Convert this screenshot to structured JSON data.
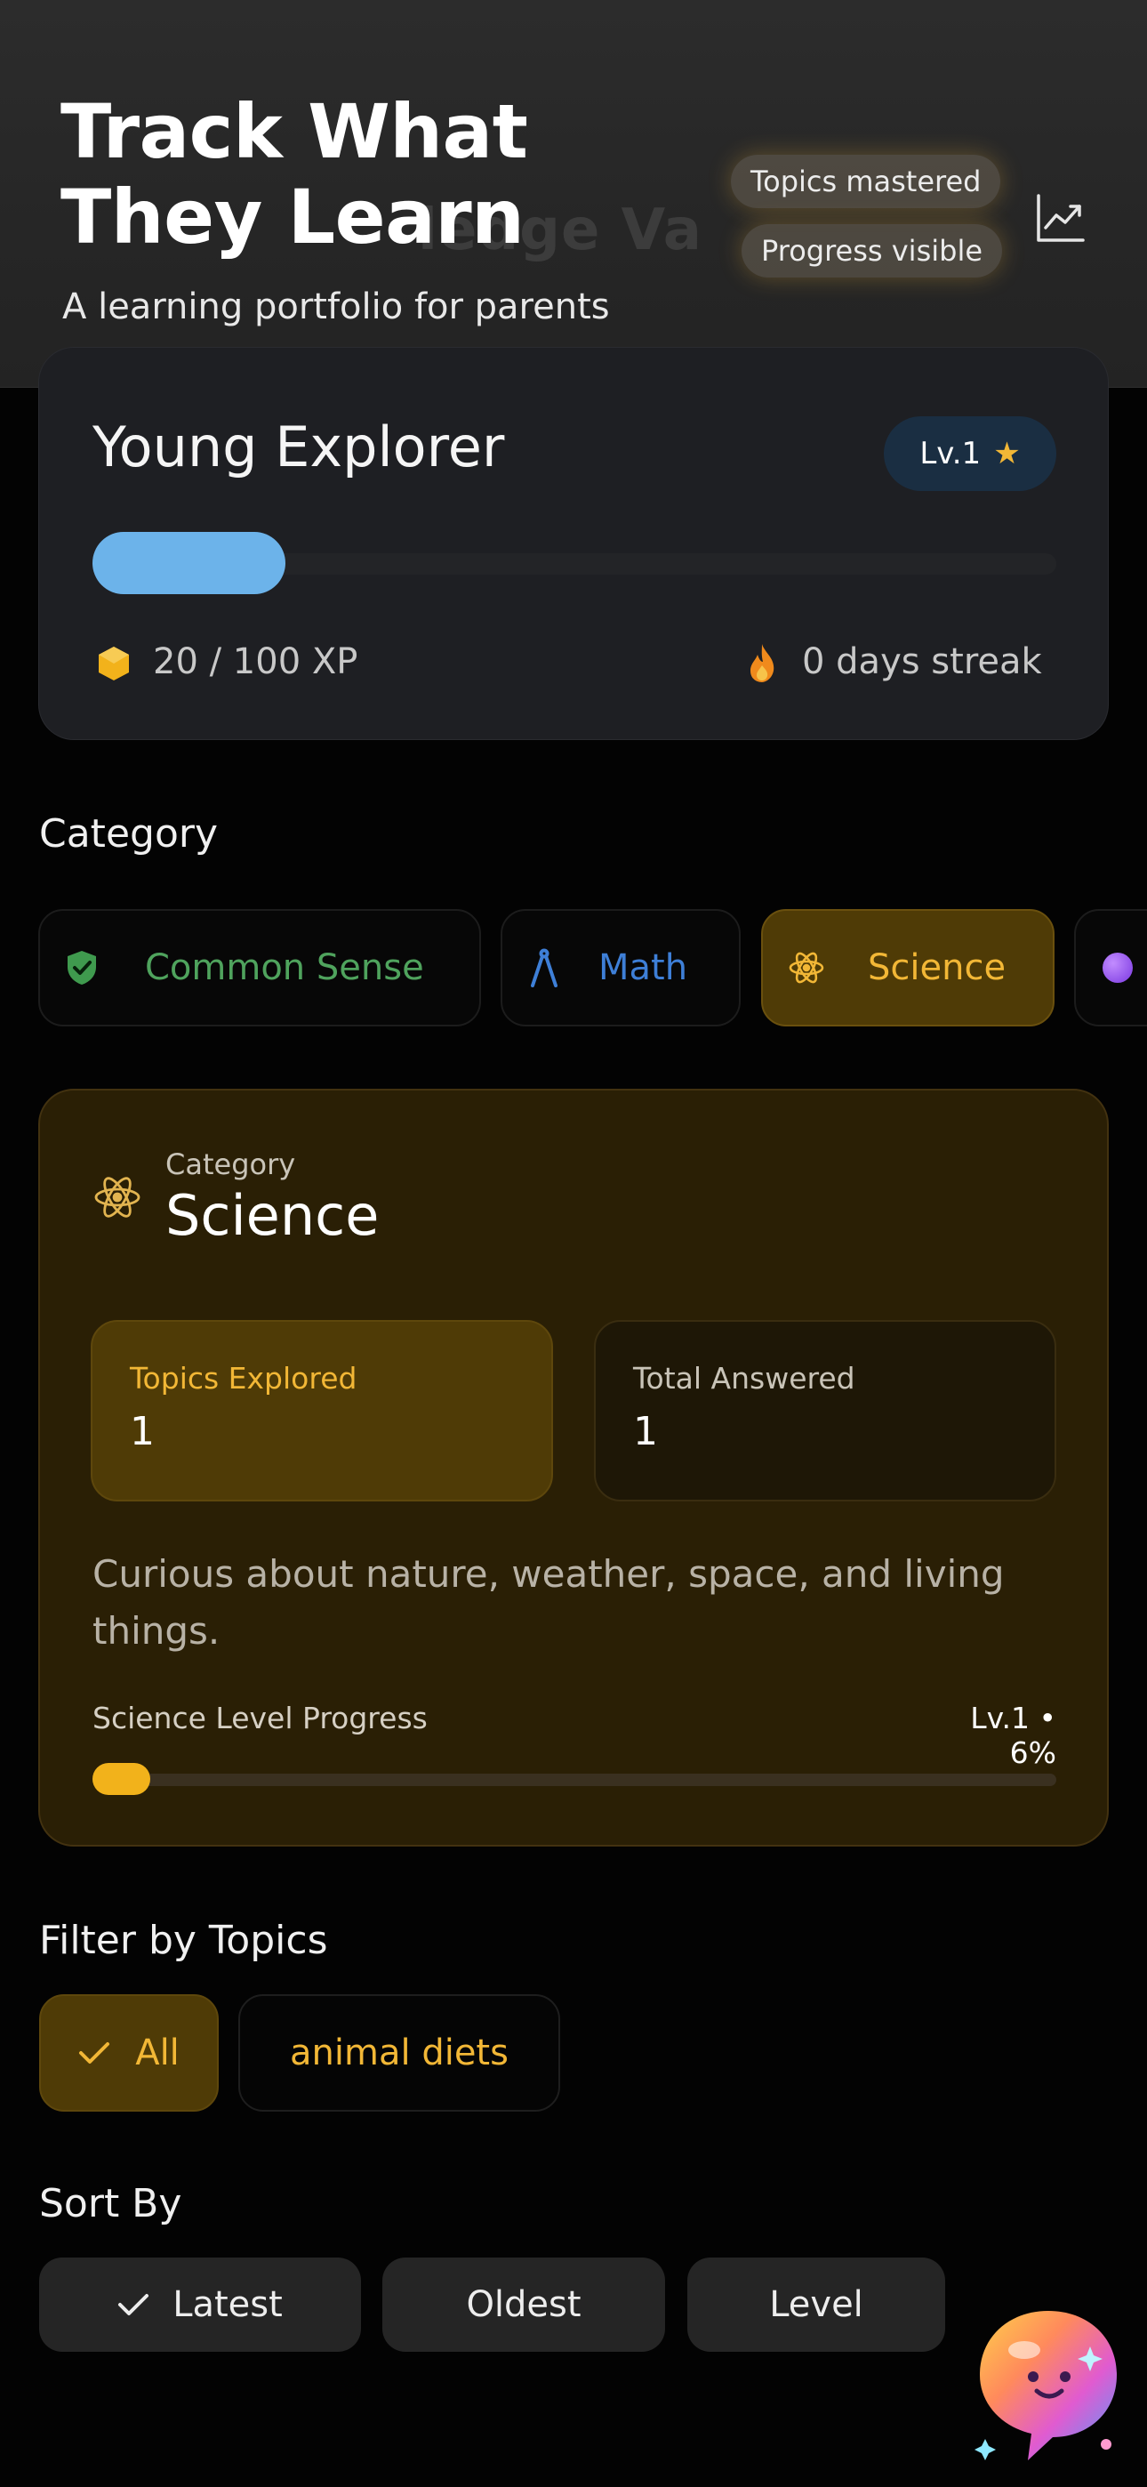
{
  "hero": {
    "title": "Track What They Learn",
    "subtitle": "A learning portfolio for parents",
    "ghost_text": "ledge Va",
    "chip_topics": "Topics mastered",
    "chip_progress": "Progress visible",
    "icon": "trending-chart-icon"
  },
  "profile": {
    "name": "Young Explorer",
    "level_badge": "Lv.1",
    "xp_fraction": 0.2,
    "xp_text": "20 / 100 XP",
    "streak_text": "0 days streak"
  },
  "category": {
    "label": "Category",
    "tabs": [
      {
        "label": "Common Sense",
        "icon": "shield-check-icon",
        "color": "#4fa35d"
      },
      {
        "label": "Math",
        "icon": "compass-icon",
        "color": "#3e7fd7"
      },
      {
        "label": "Science",
        "icon": "atom-icon",
        "color": "#f2b736",
        "selected": true
      },
      {
        "label": "",
        "icon": "purple-orb-icon"
      }
    ]
  },
  "science_card": {
    "kicker": "Category",
    "title": "Science",
    "stats": [
      {
        "label": "Topics Explored",
        "value": "1"
      },
      {
        "label": "Total Answered",
        "value": "1"
      }
    ],
    "description": "Curious about nature, weather, space, and living things.",
    "progress_label": "Science Level Progress",
    "progress_value": "Lv.1 • 6%",
    "progress_fraction": 0.06
  },
  "filter": {
    "label": "Filter by Topics",
    "chips": [
      "All",
      "animal diets"
    ],
    "selected": "All"
  },
  "sort": {
    "label": "Sort By",
    "options": [
      "Latest",
      "Oldest",
      "Level"
    ],
    "selected": "Latest"
  },
  "colors": {
    "accent": "#f2b736",
    "xp_bar": "#6cb3ea",
    "background": "#030303"
  }
}
